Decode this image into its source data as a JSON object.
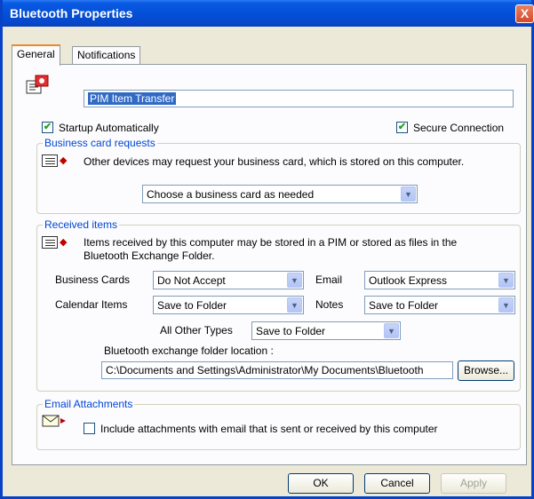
{
  "window": {
    "title": "Bluetooth Properties",
    "close_glyph": "X"
  },
  "tabs": [
    {
      "label": "General",
      "active": true
    },
    {
      "label": "Notifications",
      "active": false
    }
  ],
  "service": {
    "name": "PIM Item Transfer",
    "icon": "pim-transfer-icon"
  },
  "options": {
    "startup_label": "Startup Automatically",
    "startup_checked": true,
    "secure_label": "Secure Connection",
    "secure_checked": true
  },
  "business_card": {
    "title": "Business card requests",
    "description": "Other devices may request your business card, which is stored on this computer.",
    "selected": "Choose a business card as needed"
  },
  "received": {
    "title": "Received items",
    "description": "Items received by this computer may be stored in a PIM or stored as files in the Bluetooth Exchange Folder.",
    "business_cards_label": "Business Cards",
    "business_cards_value": "Do Not Accept",
    "email_label": "Email",
    "email_value": "Outlook Express",
    "calendar_label": "Calendar Items",
    "calendar_value": "Save to Folder",
    "notes_label": "Notes",
    "notes_value": "Save to Folder",
    "other_label": "All Other Types",
    "other_value": "Save to Folder",
    "folder_label": "Bluetooth exchange folder location :",
    "folder_value": "C:\\Documents and Settings\\Administrator\\My Documents\\Bluetooth",
    "browse_label": "Browse..."
  },
  "email_attachments": {
    "title": "Email Attachments",
    "include_label": "Include attachments with email that is sent or received by this computer",
    "include_checked": false
  },
  "buttons": {
    "ok": "OK",
    "cancel": "Cancel",
    "apply": "Apply"
  },
  "colors": {
    "titlebar": "#0450d8",
    "group_title": "#0046d5",
    "check": "#21a121"
  }
}
